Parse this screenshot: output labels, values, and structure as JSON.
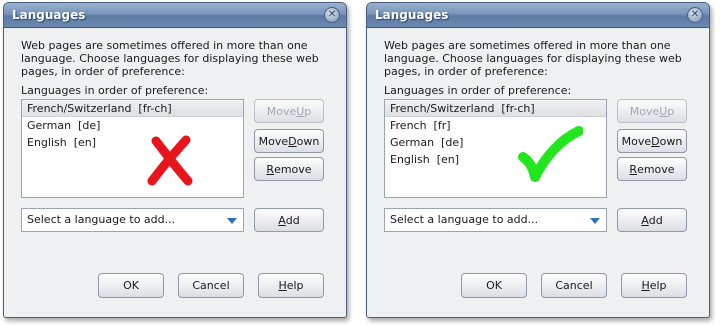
{
  "dialogs": [
    {
      "title": "Languages",
      "description": "Web pages are sometimes offered in more than one language. Choose languages for displaying these web pages, in order of preference:",
      "list_label": "Languages in order of preference:",
      "languages": [
        "French/Switzerland  [fr-ch]",
        "German  [de]",
        "English  [en]"
      ],
      "select_placeholder": "Select a language to add...",
      "buttons": {
        "move_up": {
          "pre": "Move ",
          "u": "U",
          "post": "p"
        },
        "move_down": {
          "pre": "Move ",
          "u": "D",
          "post": "own"
        },
        "remove": {
          "pre": "",
          "u": "R",
          "post": "emove"
        },
        "add": {
          "pre": "",
          "u": "A",
          "post": "dd"
        },
        "ok": "OK",
        "cancel": "Cancel",
        "help": {
          "pre": "",
          "u": "H",
          "post": "elp"
        }
      },
      "annotation": "cross-mark-icon",
      "annotation_color": "#e8141c"
    },
    {
      "title": "Languages",
      "description": "Web pages are sometimes offered in more than one language. Choose languages for displaying these web pages, in order of preference:",
      "list_label": "Languages in order of preference:",
      "languages": [
        "French/Switzerland  [fr-ch]",
        "French  [fr]",
        "German  [de]",
        "English  [en]"
      ],
      "select_placeholder": "Select a language to add...",
      "buttons": {
        "move_up": {
          "pre": "Move ",
          "u": "U",
          "post": "p"
        },
        "move_down": {
          "pre": "Move ",
          "u": "D",
          "post": "own"
        },
        "remove": {
          "pre": "",
          "u": "R",
          "post": "emove"
        },
        "add": {
          "pre": "",
          "u": "A",
          "post": "dd"
        },
        "ok": "OK",
        "cancel": "Cancel",
        "help": {
          "pre": "",
          "u": "H",
          "post": "elp"
        }
      },
      "annotation": "check-mark-icon",
      "annotation_color": "#22e61e"
    }
  ],
  "colors": {
    "titlebar": "#7794b9",
    "dialog_bg": "#eff0f2",
    "select_arrow": "#2d6fb8"
  }
}
